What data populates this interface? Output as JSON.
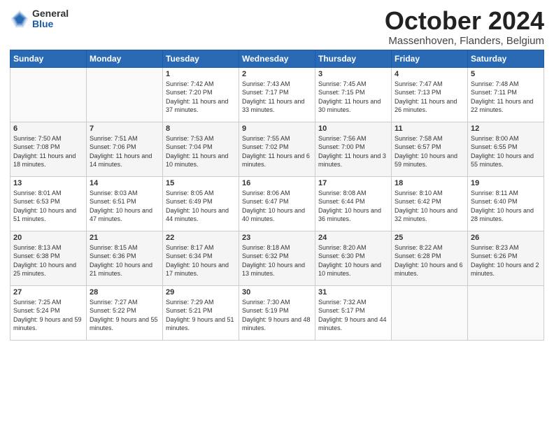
{
  "logo": {
    "general": "General",
    "blue": "Blue"
  },
  "title": "October 2024",
  "location": "Massenhoven, Flanders, Belgium",
  "weekdays": [
    "Sunday",
    "Monday",
    "Tuesday",
    "Wednesday",
    "Thursday",
    "Friday",
    "Saturday"
  ],
  "weeks": [
    [
      {
        "day": "",
        "sunrise": "",
        "sunset": "",
        "daylight": ""
      },
      {
        "day": "",
        "sunrise": "",
        "sunset": "",
        "daylight": ""
      },
      {
        "day": "1",
        "sunrise": "Sunrise: 7:42 AM",
        "sunset": "Sunset: 7:20 PM",
        "daylight": "Daylight: 11 hours and 37 minutes."
      },
      {
        "day": "2",
        "sunrise": "Sunrise: 7:43 AM",
        "sunset": "Sunset: 7:17 PM",
        "daylight": "Daylight: 11 hours and 33 minutes."
      },
      {
        "day": "3",
        "sunrise": "Sunrise: 7:45 AM",
        "sunset": "Sunset: 7:15 PM",
        "daylight": "Daylight: 11 hours and 30 minutes."
      },
      {
        "day": "4",
        "sunrise": "Sunrise: 7:47 AM",
        "sunset": "Sunset: 7:13 PM",
        "daylight": "Daylight: 11 hours and 26 minutes."
      },
      {
        "day": "5",
        "sunrise": "Sunrise: 7:48 AM",
        "sunset": "Sunset: 7:11 PM",
        "daylight": "Daylight: 11 hours and 22 minutes."
      }
    ],
    [
      {
        "day": "6",
        "sunrise": "Sunrise: 7:50 AM",
        "sunset": "Sunset: 7:08 PM",
        "daylight": "Daylight: 11 hours and 18 minutes."
      },
      {
        "day": "7",
        "sunrise": "Sunrise: 7:51 AM",
        "sunset": "Sunset: 7:06 PM",
        "daylight": "Daylight: 11 hours and 14 minutes."
      },
      {
        "day": "8",
        "sunrise": "Sunrise: 7:53 AM",
        "sunset": "Sunset: 7:04 PM",
        "daylight": "Daylight: 11 hours and 10 minutes."
      },
      {
        "day": "9",
        "sunrise": "Sunrise: 7:55 AM",
        "sunset": "Sunset: 7:02 PM",
        "daylight": "Daylight: 11 hours and 6 minutes."
      },
      {
        "day": "10",
        "sunrise": "Sunrise: 7:56 AM",
        "sunset": "Sunset: 7:00 PM",
        "daylight": "Daylight: 11 hours and 3 minutes."
      },
      {
        "day": "11",
        "sunrise": "Sunrise: 7:58 AM",
        "sunset": "Sunset: 6:57 PM",
        "daylight": "Daylight: 10 hours and 59 minutes."
      },
      {
        "day": "12",
        "sunrise": "Sunrise: 8:00 AM",
        "sunset": "Sunset: 6:55 PM",
        "daylight": "Daylight: 10 hours and 55 minutes."
      }
    ],
    [
      {
        "day": "13",
        "sunrise": "Sunrise: 8:01 AM",
        "sunset": "Sunset: 6:53 PM",
        "daylight": "Daylight: 10 hours and 51 minutes."
      },
      {
        "day": "14",
        "sunrise": "Sunrise: 8:03 AM",
        "sunset": "Sunset: 6:51 PM",
        "daylight": "Daylight: 10 hours and 47 minutes."
      },
      {
        "day": "15",
        "sunrise": "Sunrise: 8:05 AM",
        "sunset": "Sunset: 6:49 PM",
        "daylight": "Daylight: 10 hours and 44 minutes."
      },
      {
        "day": "16",
        "sunrise": "Sunrise: 8:06 AM",
        "sunset": "Sunset: 6:47 PM",
        "daylight": "Daylight: 10 hours and 40 minutes."
      },
      {
        "day": "17",
        "sunrise": "Sunrise: 8:08 AM",
        "sunset": "Sunset: 6:44 PM",
        "daylight": "Daylight: 10 hours and 36 minutes."
      },
      {
        "day": "18",
        "sunrise": "Sunrise: 8:10 AM",
        "sunset": "Sunset: 6:42 PM",
        "daylight": "Daylight: 10 hours and 32 minutes."
      },
      {
        "day": "19",
        "sunrise": "Sunrise: 8:11 AM",
        "sunset": "Sunset: 6:40 PM",
        "daylight": "Daylight: 10 hours and 28 minutes."
      }
    ],
    [
      {
        "day": "20",
        "sunrise": "Sunrise: 8:13 AM",
        "sunset": "Sunset: 6:38 PM",
        "daylight": "Daylight: 10 hours and 25 minutes."
      },
      {
        "day": "21",
        "sunrise": "Sunrise: 8:15 AM",
        "sunset": "Sunset: 6:36 PM",
        "daylight": "Daylight: 10 hours and 21 minutes."
      },
      {
        "day": "22",
        "sunrise": "Sunrise: 8:17 AM",
        "sunset": "Sunset: 6:34 PM",
        "daylight": "Daylight: 10 hours and 17 minutes."
      },
      {
        "day": "23",
        "sunrise": "Sunrise: 8:18 AM",
        "sunset": "Sunset: 6:32 PM",
        "daylight": "Daylight: 10 hours and 13 minutes."
      },
      {
        "day": "24",
        "sunrise": "Sunrise: 8:20 AM",
        "sunset": "Sunset: 6:30 PM",
        "daylight": "Daylight: 10 hours and 10 minutes."
      },
      {
        "day": "25",
        "sunrise": "Sunrise: 8:22 AM",
        "sunset": "Sunset: 6:28 PM",
        "daylight": "Daylight: 10 hours and 6 minutes."
      },
      {
        "day": "26",
        "sunrise": "Sunrise: 8:23 AM",
        "sunset": "Sunset: 6:26 PM",
        "daylight": "Daylight: 10 hours and 2 minutes."
      }
    ],
    [
      {
        "day": "27",
        "sunrise": "Sunrise: 7:25 AM",
        "sunset": "Sunset: 5:24 PM",
        "daylight": "Daylight: 9 hours and 59 minutes."
      },
      {
        "day": "28",
        "sunrise": "Sunrise: 7:27 AM",
        "sunset": "Sunset: 5:22 PM",
        "daylight": "Daylight: 9 hours and 55 minutes."
      },
      {
        "day": "29",
        "sunrise": "Sunrise: 7:29 AM",
        "sunset": "Sunset: 5:21 PM",
        "daylight": "Daylight: 9 hours and 51 minutes."
      },
      {
        "day": "30",
        "sunrise": "Sunrise: 7:30 AM",
        "sunset": "Sunset: 5:19 PM",
        "daylight": "Daylight: 9 hours and 48 minutes."
      },
      {
        "day": "31",
        "sunrise": "Sunrise: 7:32 AM",
        "sunset": "Sunset: 5:17 PM",
        "daylight": "Daylight: 9 hours and 44 minutes."
      },
      {
        "day": "",
        "sunrise": "",
        "sunset": "",
        "daylight": ""
      },
      {
        "day": "",
        "sunrise": "",
        "sunset": "",
        "daylight": ""
      }
    ]
  ]
}
